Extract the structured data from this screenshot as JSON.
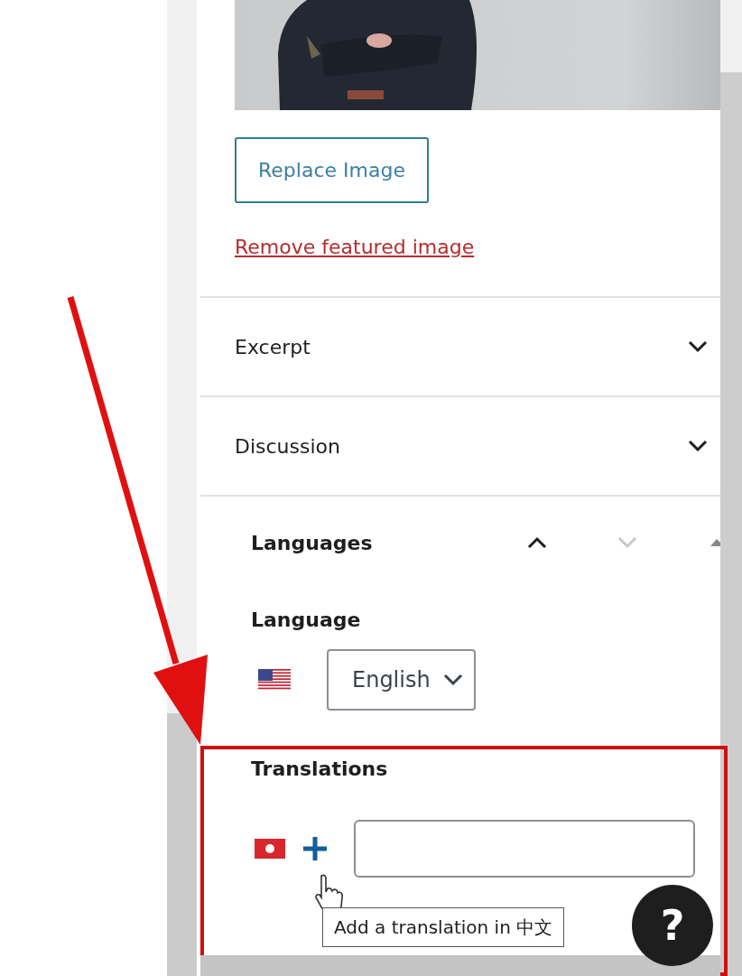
{
  "replace_button": "Replace Image",
  "remove_link": "Remove featured image",
  "panels": [
    {
      "title": "Excerpt",
      "expanded": false
    },
    {
      "title": "Discussion",
      "expanded": false
    },
    {
      "title": "Languages",
      "expanded": true
    }
  ],
  "language": {
    "label": "Language",
    "value": "English"
  },
  "translations": {
    "label": "Translations",
    "tooltip": "Add a translation in 中文"
  },
  "help_button": "?"
}
